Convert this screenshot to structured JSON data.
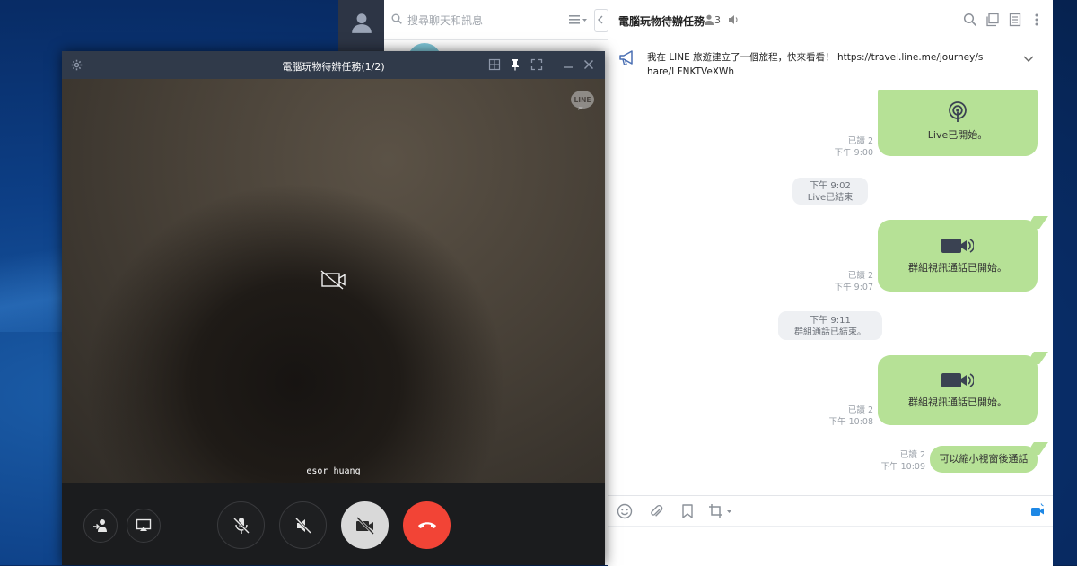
{
  "search": {
    "placeholder": "搜尋聊天和訊息"
  },
  "chat": {
    "title": "電腦玩物待辦任務",
    "member_count": "3",
    "notice": "我在 LINE 旅遊建立了一個旅程，快來看看！ https://travel.line.me/journey/share/LENKTVeXWh",
    "messages": [
      {
        "type": "sent",
        "icon": "live-icon",
        "text": "Live已開始。",
        "read": "已讀 2",
        "time": "下午 9:00"
      },
      {
        "type": "system",
        "time": "下午 9:02",
        "text": "Live已結束"
      },
      {
        "type": "sent",
        "icon": "video-camera-icon",
        "text": "群組視訊通話已開始。",
        "read": "已讀 2",
        "time": "下午 9:07"
      },
      {
        "type": "system",
        "time": "下午 9:11",
        "text": "群組通話已結束。"
      },
      {
        "type": "sent",
        "icon": "video-camera-icon",
        "text": "群組視訊通話已開始。",
        "read": "已讀 2",
        "time": "下午 10:08"
      },
      {
        "type": "sent",
        "text": "可以縮小視窗後通話",
        "read": "已讀 2",
        "time": "下午 10:09"
      }
    ]
  },
  "call": {
    "title": "電腦玩物待辦任務(1/2)",
    "caller_name": "esor huang",
    "badge": "LINE"
  },
  "colors": {
    "bubble": "#b6e196",
    "end_call": "#f24436",
    "sidebar": "#2d3545",
    "call_titlebar": "#303a4a"
  }
}
